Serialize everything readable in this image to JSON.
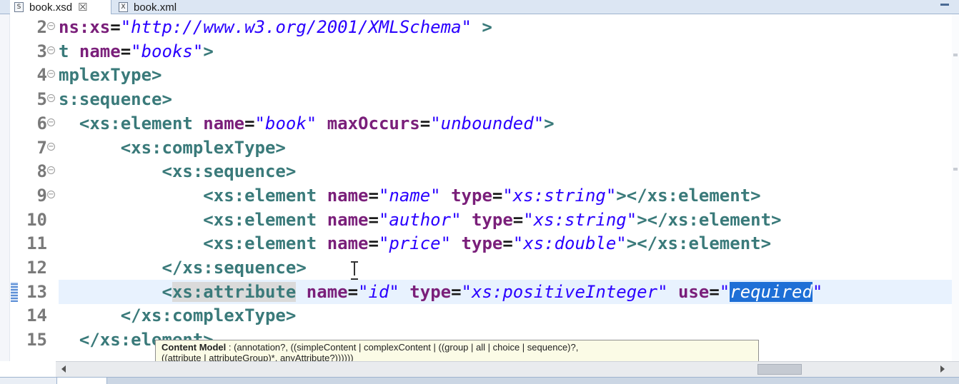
{
  "tabs": [
    {
      "icon": "S",
      "label": "book.xsd",
      "close": "☒",
      "active": true
    },
    {
      "icon": "X",
      "label": "book.xml",
      "active": false
    }
  ],
  "lines": [
    {
      "num": "2",
      "fold": "⊖",
      "parts": [
        {
          "t": "ns:xs",
          "c": "attr"
        },
        {
          "t": "=",
          "c": "eq"
        },
        {
          "t": "\"http://www.w3.org/2001/XMLSchema\"",
          "c": "val"
        },
        {
          "t": " >",
          "c": "tag"
        }
      ]
    },
    {
      "num": "3",
      "fold": "⊖",
      "parts": [
        {
          "t": "t ",
          "c": "tag"
        },
        {
          "t": "name",
          "c": "attr"
        },
        {
          "t": "=",
          "c": "eq"
        },
        {
          "t": "\"books\"",
          "c": "val"
        },
        {
          "t": ">",
          "c": "tag"
        }
      ]
    },
    {
      "num": "4",
      "fold": "⊖",
      "parts": [
        {
          "t": "mplexType>",
          "c": "tag"
        }
      ]
    },
    {
      "num": "5",
      "fold": "⊖",
      "parts": [
        {
          "t": "s:sequence>",
          "c": "tag"
        }
      ]
    },
    {
      "num": "6",
      "fold": "⊖",
      "parts": [
        {
          "t": "  <xs:element ",
          "c": "tag"
        },
        {
          "t": "name",
          "c": "attr"
        },
        {
          "t": "=",
          "c": "eq"
        },
        {
          "t": "\"book\"",
          "c": "val"
        },
        {
          "t": " ",
          "c": "eq"
        },
        {
          "t": "maxOccurs",
          "c": "attr"
        },
        {
          "t": "=",
          "c": "eq"
        },
        {
          "t": "\"unbounded\"",
          "c": "val"
        },
        {
          "t": ">",
          "c": "tag"
        }
      ]
    },
    {
      "num": "7",
      "fold": "⊖",
      "parts": [
        {
          "t": "      <xs:complexType>",
          "c": "tag"
        }
      ]
    },
    {
      "num": "8",
      "fold": "⊖",
      "parts": [
        {
          "t": "          <xs:sequence>",
          "c": "tag"
        }
      ]
    },
    {
      "num": "9",
      "fold": "⊖",
      "parts": [
        {
          "t": "              <xs:element ",
          "c": "tag"
        },
        {
          "t": "name",
          "c": "attr"
        },
        {
          "t": "=",
          "c": "eq"
        },
        {
          "t": "\"name\"",
          "c": "val"
        },
        {
          "t": " ",
          "c": "eq"
        },
        {
          "t": "type",
          "c": "attr"
        },
        {
          "t": "=",
          "c": "eq"
        },
        {
          "t": "\"xs:string\"",
          "c": "val"
        },
        {
          "t": "></xs:element>",
          "c": "tag"
        }
      ]
    },
    {
      "num": "10",
      "fold": "",
      "parts": [
        {
          "t": "              <xs:element ",
          "c": "tag"
        },
        {
          "t": "name",
          "c": "attr"
        },
        {
          "t": "=",
          "c": "eq"
        },
        {
          "t": "\"author\"",
          "c": "val"
        },
        {
          "t": " ",
          "c": "eq"
        },
        {
          "t": "type",
          "c": "attr"
        },
        {
          "t": "=",
          "c": "eq"
        },
        {
          "t": "\"xs:string\"",
          "c": "val"
        },
        {
          "t": "></xs:element>",
          "c": "tag"
        }
      ]
    },
    {
      "num": "11",
      "fold": "",
      "parts": [
        {
          "t": "              <xs:element ",
          "c": "tag"
        },
        {
          "t": "name",
          "c": "attr"
        },
        {
          "t": "=",
          "c": "eq"
        },
        {
          "t": "\"price\"",
          "c": "val"
        },
        {
          "t": " ",
          "c": "eq"
        },
        {
          "t": "type",
          "c": "attr"
        },
        {
          "t": "=",
          "c": "eq"
        },
        {
          "t": "\"xs:double\"",
          "c": "val"
        },
        {
          "t": "></xs:element>",
          "c": "tag"
        }
      ]
    },
    {
      "num": "12",
      "fold": "",
      "parts": [
        {
          "t": "          </xs:sequence>",
          "c": "tag"
        }
      ]
    },
    {
      "num": "13",
      "fold": "",
      "current": true,
      "parts": [
        {
          "t": "          <",
          "c": "tag"
        },
        {
          "t": "xs:attribute",
          "c": "tag hl-tag"
        },
        {
          "t": " ",
          "c": "eq"
        },
        {
          "t": "name",
          "c": "attr"
        },
        {
          "t": "=",
          "c": "eq"
        },
        {
          "t": "\"id\"",
          "c": "val"
        },
        {
          "t": " ",
          "c": "eq"
        },
        {
          "t": "type",
          "c": "attr"
        },
        {
          "t": "=",
          "c": "eq"
        },
        {
          "t": "\"xs:positiveInteger\"",
          "c": "val"
        },
        {
          "t": " ",
          "c": "eq"
        },
        {
          "t": "use",
          "c": "attr"
        },
        {
          "t": "=",
          "c": "eq"
        },
        {
          "t": "\"",
          "c": "val"
        },
        {
          "t": "required",
          "c": "val sel"
        },
        {
          "t": "\"",
          "c": "val"
        }
      ]
    },
    {
      "num": "14",
      "fold": "",
      "parts": [
        {
          "t": "      </xs:complexType>",
          "c": "tag"
        }
      ]
    },
    {
      "num": "15",
      "fold": "",
      "parts": [
        {
          "t": "  </xs:element>",
          "c": "tag"
        }
      ]
    }
  ],
  "hover": {
    "line1_bold": "Content Model",
    "line1": " : (annotation?, ((simpleContent | complexContent | ((group | all | choice | sequence)?,",
    "line2": "((attribute | attributeGroup)*, anyAttribute?))))))"
  },
  "colors": {
    "tag": "#3a7a7a",
    "attribute": "#7a1f7a",
    "value": "#2a00ff",
    "selection": "#1e6fd6",
    "current_line": "#e8f2fe"
  }
}
